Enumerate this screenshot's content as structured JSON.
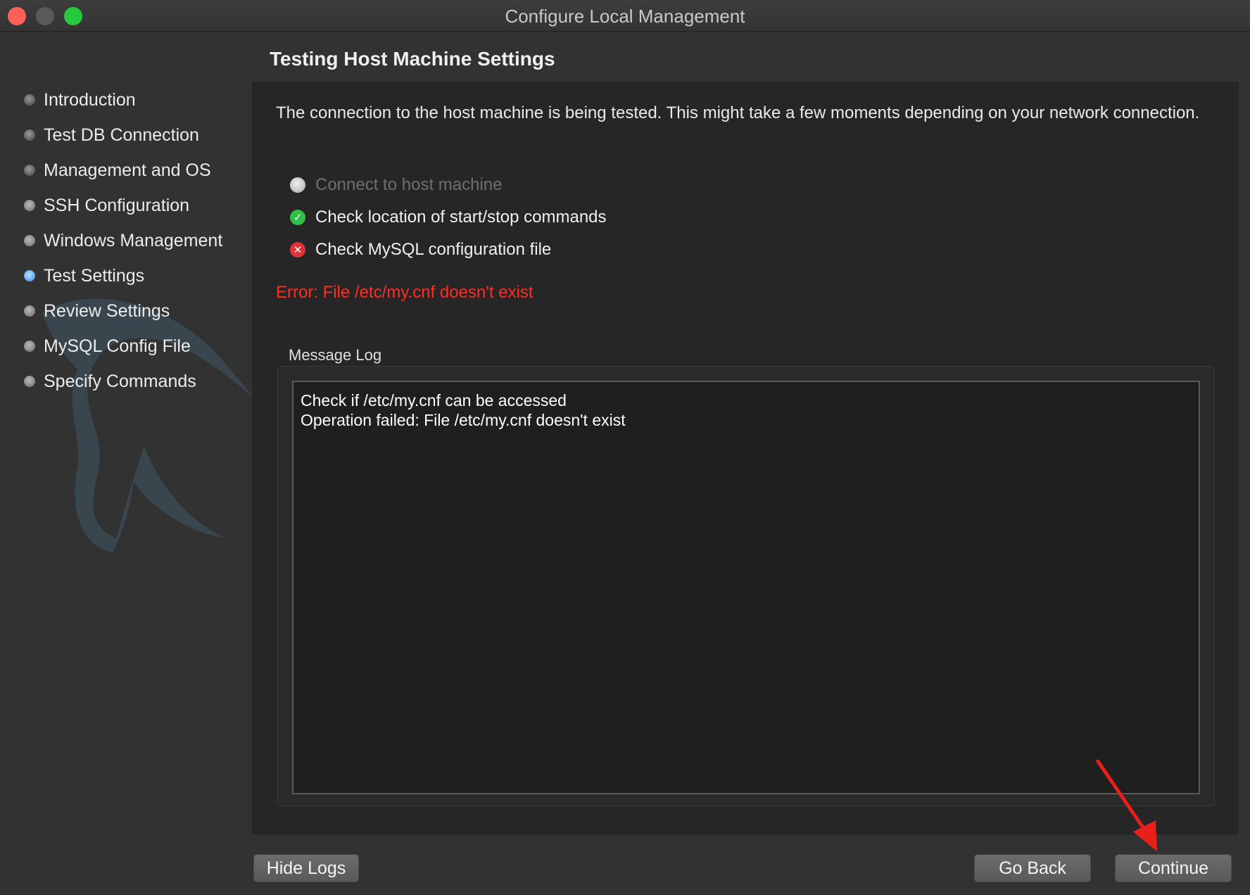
{
  "window": {
    "title": "Configure Local Management"
  },
  "sidebar": {
    "steps": [
      {
        "label": "Introduction",
        "state": "done"
      },
      {
        "label": "Test DB Connection",
        "state": "done"
      },
      {
        "label": "Management and OS",
        "state": "done"
      },
      {
        "label": "SSH Configuration",
        "state": "pending"
      },
      {
        "label": "Windows Management",
        "state": "pending"
      },
      {
        "label": "Test Settings",
        "state": "active"
      },
      {
        "label": "Review Settings",
        "state": "pending"
      },
      {
        "label": "MySQL Config File",
        "state": "pending"
      },
      {
        "label": "Specify Commands",
        "state": "pending"
      }
    ]
  },
  "main": {
    "heading": "Testing Host Machine Settings",
    "description": "The connection to the host machine is being tested. This might take a few moments depending on your network connection.",
    "checks": [
      {
        "label": "Connect to host machine",
        "status": "pending"
      },
      {
        "label": "Check location of start/stop commands",
        "status": "success"
      },
      {
        "label": "Check MySQL configuration file",
        "status": "failed"
      }
    ],
    "error": "Error: File /etc/my.cnf doesn't exist",
    "log": {
      "title": "Message Log",
      "lines": [
        "Check if /etc/my.cnf can be accessed",
        "Operation failed: File /etc/my.cnf doesn't exist"
      ]
    }
  },
  "buttons": {
    "hide_logs": "Hide Logs",
    "go_back": "Go Back",
    "continue": "Continue"
  },
  "colors": {
    "error": "#ff2d26",
    "success": "#30c04a",
    "failed": "#e0323a",
    "active_step": "#2f86e9",
    "annotation_arrow": "#e8201a"
  }
}
